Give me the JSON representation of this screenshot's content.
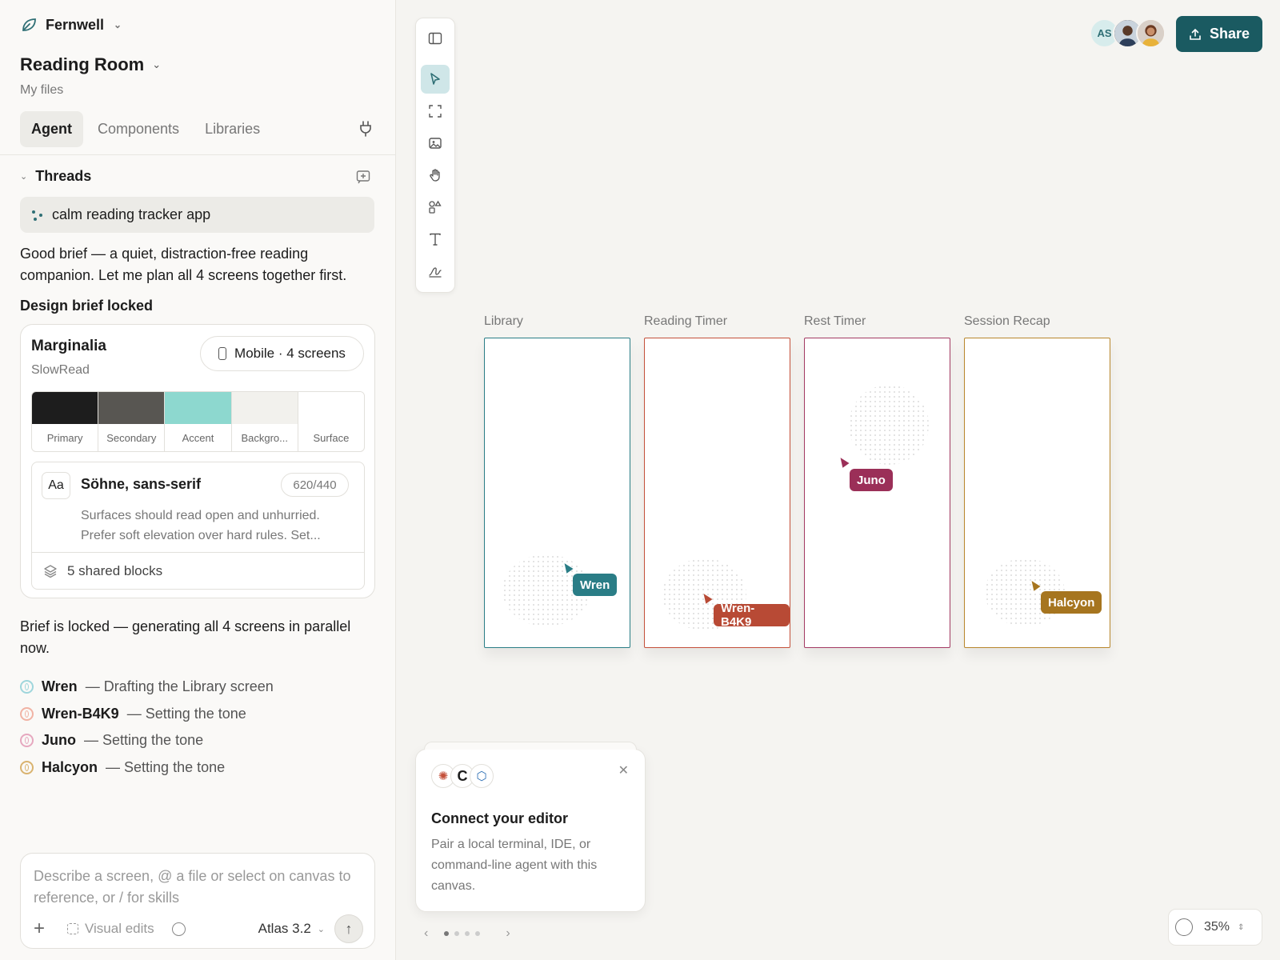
{
  "workspace": {
    "name": "Fernwell"
  },
  "project": {
    "title": "Reading Room",
    "location": "My files"
  },
  "tabs": [
    {
      "label": "Agent",
      "active": true
    },
    {
      "label": "Components",
      "active": false
    },
    {
      "label": "Libraries",
      "active": false
    }
  ],
  "threads": {
    "header": "Threads",
    "items": [
      {
        "title": "calm reading tracker app"
      }
    ]
  },
  "messages": {
    "intro": "Good brief — a quiet, distraction-free reading companion. Let me plan all 4 screens together first.",
    "brief_heading": "Design brief locked",
    "generating": "Brief is locked — generating all 4 screens in parallel now."
  },
  "brief": {
    "name": "Marginalia",
    "subtitle": "SlowRead",
    "platform": "Mobile · 4 screens",
    "palette": [
      {
        "label": "Primary",
        "color": "#1d1d1d"
      },
      {
        "label": "Secondary",
        "color": "#585652"
      },
      {
        "label": "Accent",
        "color": "#8dd8cf"
      },
      {
        "label": "Backgro...",
        "color": "#f2f1ed"
      },
      {
        "label": "Surface",
        "color": "#ffffff"
      }
    ],
    "typography": {
      "sample": "Aa",
      "font": "Söhne, sans-serif",
      "weights": "620/440",
      "description": "Surfaces should read open and unhurried. Prefer soft elevation over hard rules. Set..."
    },
    "shared_blocks": "5 shared blocks"
  },
  "agents": [
    {
      "name": "Wren",
      "status": "— Drafting the Library screen",
      "color": "#9fd6dc"
    },
    {
      "name": "Wren-B4K9",
      "status": "— Setting the tone",
      "color": "#f1b3a4"
    },
    {
      "name": "Juno",
      "status": "— Setting the tone",
      "color": "#e6a8bf"
    },
    {
      "name": "Halcyon",
      "status": "— Setting the tone",
      "color": "#d9b36f"
    }
  ],
  "composer": {
    "placeholder": "Describe a screen, @ a file or select on canvas to reference, or / for skills",
    "visual_edits": "Visual edits",
    "model": "Atlas 3.2"
  },
  "header": {
    "avatar_initials": "AS",
    "share_label": "Share"
  },
  "frames": [
    {
      "label": "Library",
      "border": "#2a7d86",
      "cursor_name": "Wren",
      "cursor_color": "#2a7d86"
    },
    {
      "label": "Reading Timer",
      "border": "#c4503a",
      "cursor_name": "Wren-B4K9",
      "cursor_color": "#b84a35"
    },
    {
      "label": "Rest Timer",
      "border": "#a33a62",
      "cursor_name": "Juno",
      "cursor_color": "#9b2f58"
    },
    {
      "label": "Session Recap",
      "border": "#b8862c",
      "cursor_name": "Halcyon",
      "cursor_color": "#a6751f"
    }
  ],
  "connect": {
    "title": "Connect your editor",
    "body": "Pair a local terminal, IDE, or command-line agent with this canvas.",
    "logos": [
      "sun-logo",
      "c-logo",
      "hex-logo"
    ]
  },
  "pager": {
    "pages": 4,
    "current": 1
  },
  "zoom": {
    "level": "35%"
  },
  "colors": {
    "accent": "#1a5a61",
    "panel_bg": "#faf9f7",
    "canvas_bg": "#f5f4f1"
  }
}
